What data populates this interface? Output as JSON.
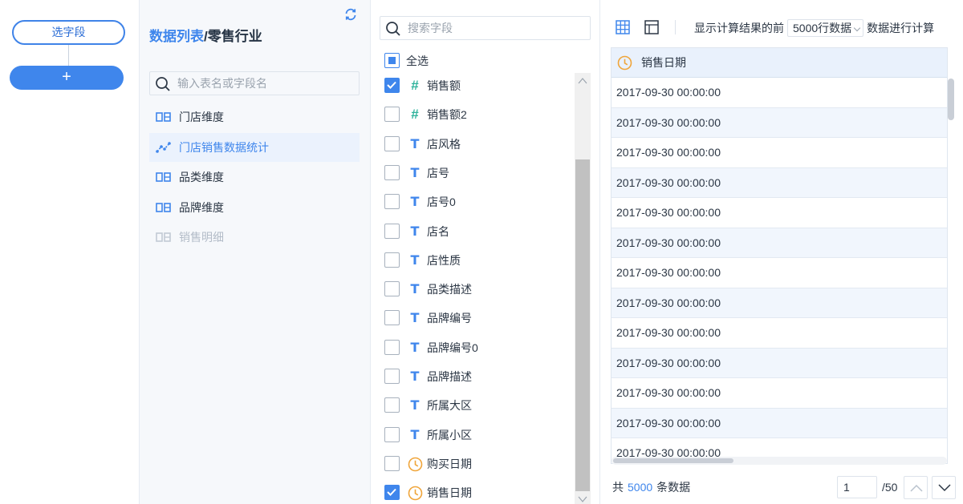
{
  "flow": {
    "node_label": "选字段",
    "add_label": "+"
  },
  "tables": {
    "breadcrumb_root": "数据列表",
    "breadcrumb_sep": "/",
    "breadcrumb_current": "零售行业",
    "search_placeholder": "输入表名或字段名",
    "items": [
      {
        "label": "门店维度",
        "icon": "dimension-table-icon",
        "state": "normal"
      },
      {
        "label": "门店销售数据统计",
        "icon": "analysis-table-icon",
        "state": "active"
      },
      {
        "label": "品类维度",
        "icon": "dimension-table-icon",
        "state": "normal"
      },
      {
        "label": "品牌维度",
        "icon": "dimension-table-icon",
        "state": "normal"
      },
      {
        "label": "销售明细",
        "icon": "dimension-table-icon",
        "state": "disabled"
      }
    ]
  },
  "fields": {
    "search_placeholder": "搜索字段",
    "select_all_label": "全选",
    "items": [
      {
        "name": "销售额",
        "type": "number",
        "type_glyph": "#",
        "checked": true
      },
      {
        "name": "销售额2",
        "type": "number",
        "type_glyph": "#",
        "checked": false
      },
      {
        "name": "店风格",
        "type": "text",
        "type_glyph": "T",
        "checked": false
      },
      {
        "name": "店号",
        "type": "text",
        "type_glyph": "T",
        "checked": false
      },
      {
        "name": "店号0",
        "type": "text",
        "type_glyph": "T",
        "checked": false
      },
      {
        "name": "店名",
        "type": "text",
        "type_glyph": "T",
        "checked": false
      },
      {
        "name": "店性质",
        "type": "text",
        "type_glyph": "T",
        "checked": false
      },
      {
        "name": "品类描述",
        "type": "text",
        "type_glyph": "T",
        "checked": false
      },
      {
        "name": "品牌编号",
        "type": "text",
        "type_glyph": "T",
        "checked": false
      },
      {
        "name": "品牌编号0",
        "type": "text",
        "type_glyph": "T",
        "checked": false
      },
      {
        "name": "品牌描述",
        "type": "text",
        "type_glyph": "T",
        "checked": false
      },
      {
        "name": "所属大区",
        "type": "text",
        "type_glyph": "T",
        "checked": false
      },
      {
        "name": "所属小区",
        "type": "text",
        "type_glyph": "T",
        "checked": false
      },
      {
        "name": "购买日期",
        "type": "date",
        "type_glyph": "",
        "checked": false
      },
      {
        "name": "销售日期",
        "type": "date",
        "type_glyph": "",
        "checked": true
      }
    ]
  },
  "preview": {
    "calc_prefix": "显示计算结果的前",
    "calc_select": "5000行数据",
    "calc_suffix": "数据进行计算",
    "column_header": "销售日期",
    "rows": [
      "2017-09-30 00:00:00",
      "2017-09-30 00:00:00",
      "2017-09-30 00:00:00",
      "2017-09-30 00:00:00",
      "2017-09-30 00:00:00",
      "2017-09-30 00:00:00",
      "2017-09-30 00:00:00",
      "2017-09-30 00:00:00",
      "2017-09-30 00:00:00",
      "2017-09-30 00:00:00",
      "2017-09-30 00:00:00",
      "2017-09-30 00:00:00",
      "2017-09-30 00:00:00"
    ],
    "total_prefix": "共",
    "total_count": "5000",
    "total_suffix": "条数据",
    "page_current": "1",
    "page_total": "/50"
  },
  "colors": {
    "accent": "#3f86ec",
    "number_type": "#2fb39c",
    "date_type": "#f0a53a",
    "row_alt": "#f1f6fd"
  }
}
